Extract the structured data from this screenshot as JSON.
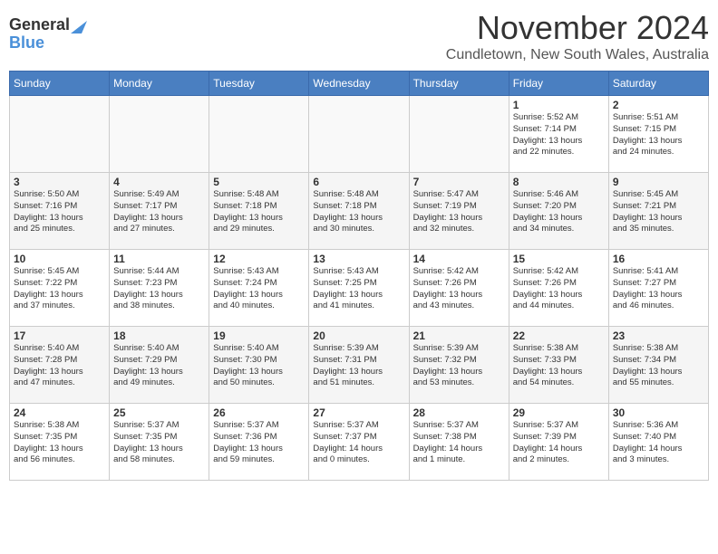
{
  "header": {
    "logo_line1": "General",
    "logo_line2": "Blue",
    "month": "November 2024",
    "location": "Cundletown, New South Wales, Australia"
  },
  "weekdays": [
    "Sunday",
    "Monday",
    "Tuesday",
    "Wednesday",
    "Thursday",
    "Friday",
    "Saturday"
  ],
  "weeks": [
    [
      {
        "day": "",
        "info": ""
      },
      {
        "day": "",
        "info": ""
      },
      {
        "day": "",
        "info": ""
      },
      {
        "day": "",
        "info": ""
      },
      {
        "day": "",
        "info": ""
      },
      {
        "day": "1",
        "info": "Sunrise: 5:52 AM\nSunset: 7:14 PM\nDaylight: 13 hours\nand 22 minutes."
      },
      {
        "day": "2",
        "info": "Sunrise: 5:51 AM\nSunset: 7:15 PM\nDaylight: 13 hours\nand 24 minutes."
      }
    ],
    [
      {
        "day": "3",
        "info": "Sunrise: 5:50 AM\nSunset: 7:16 PM\nDaylight: 13 hours\nand 25 minutes."
      },
      {
        "day": "4",
        "info": "Sunrise: 5:49 AM\nSunset: 7:17 PM\nDaylight: 13 hours\nand 27 minutes."
      },
      {
        "day": "5",
        "info": "Sunrise: 5:48 AM\nSunset: 7:18 PM\nDaylight: 13 hours\nand 29 minutes."
      },
      {
        "day": "6",
        "info": "Sunrise: 5:48 AM\nSunset: 7:18 PM\nDaylight: 13 hours\nand 30 minutes."
      },
      {
        "day": "7",
        "info": "Sunrise: 5:47 AM\nSunset: 7:19 PM\nDaylight: 13 hours\nand 32 minutes."
      },
      {
        "day": "8",
        "info": "Sunrise: 5:46 AM\nSunset: 7:20 PM\nDaylight: 13 hours\nand 34 minutes."
      },
      {
        "day": "9",
        "info": "Sunrise: 5:45 AM\nSunset: 7:21 PM\nDaylight: 13 hours\nand 35 minutes."
      }
    ],
    [
      {
        "day": "10",
        "info": "Sunrise: 5:45 AM\nSunset: 7:22 PM\nDaylight: 13 hours\nand 37 minutes."
      },
      {
        "day": "11",
        "info": "Sunrise: 5:44 AM\nSunset: 7:23 PM\nDaylight: 13 hours\nand 38 minutes."
      },
      {
        "day": "12",
        "info": "Sunrise: 5:43 AM\nSunset: 7:24 PM\nDaylight: 13 hours\nand 40 minutes."
      },
      {
        "day": "13",
        "info": "Sunrise: 5:43 AM\nSunset: 7:25 PM\nDaylight: 13 hours\nand 41 minutes."
      },
      {
        "day": "14",
        "info": "Sunrise: 5:42 AM\nSunset: 7:26 PM\nDaylight: 13 hours\nand 43 minutes."
      },
      {
        "day": "15",
        "info": "Sunrise: 5:42 AM\nSunset: 7:26 PM\nDaylight: 13 hours\nand 44 minutes."
      },
      {
        "day": "16",
        "info": "Sunrise: 5:41 AM\nSunset: 7:27 PM\nDaylight: 13 hours\nand 46 minutes."
      }
    ],
    [
      {
        "day": "17",
        "info": "Sunrise: 5:40 AM\nSunset: 7:28 PM\nDaylight: 13 hours\nand 47 minutes."
      },
      {
        "day": "18",
        "info": "Sunrise: 5:40 AM\nSunset: 7:29 PM\nDaylight: 13 hours\nand 49 minutes."
      },
      {
        "day": "19",
        "info": "Sunrise: 5:40 AM\nSunset: 7:30 PM\nDaylight: 13 hours\nand 50 minutes."
      },
      {
        "day": "20",
        "info": "Sunrise: 5:39 AM\nSunset: 7:31 PM\nDaylight: 13 hours\nand 51 minutes."
      },
      {
        "day": "21",
        "info": "Sunrise: 5:39 AM\nSunset: 7:32 PM\nDaylight: 13 hours\nand 53 minutes."
      },
      {
        "day": "22",
        "info": "Sunrise: 5:38 AM\nSunset: 7:33 PM\nDaylight: 13 hours\nand 54 minutes."
      },
      {
        "day": "23",
        "info": "Sunrise: 5:38 AM\nSunset: 7:34 PM\nDaylight: 13 hours\nand 55 minutes."
      }
    ],
    [
      {
        "day": "24",
        "info": "Sunrise: 5:38 AM\nSunset: 7:35 PM\nDaylight: 13 hours\nand 56 minutes."
      },
      {
        "day": "25",
        "info": "Sunrise: 5:37 AM\nSunset: 7:35 PM\nDaylight: 13 hours\nand 58 minutes."
      },
      {
        "day": "26",
        "info": "Sunrise: 5:37 AM\nSunset: 7:36 PM\nDaylight: 13 hours\nand 59 minutes."
      },
      {
        "day": "27",
        "info": "Sunrise: 5:37 AM\nSunset: 7:37 PM\nDaylight: 14 hours\nand 0 minutes."
      },
      {
        "day": "28",
        "info": "Sunrise: 5:37 AM\nSunset: 7:38 PM\nDaylight: 14 hours\nand 1 minute."
      },
      {
        "day": "29",
        "info": "Sunrise: 5:37 AM\nSunset: 7:39 PM\nDaylight: 14 hours\nand 2 minutes."
      },
      {
        "day": "30",
        "info": "Sunrise: 5:36 AM\nSunset: 7:40 PM\nDaylight: 14 hours\nand 3 minutes."
      }
    ]
  ]
}
